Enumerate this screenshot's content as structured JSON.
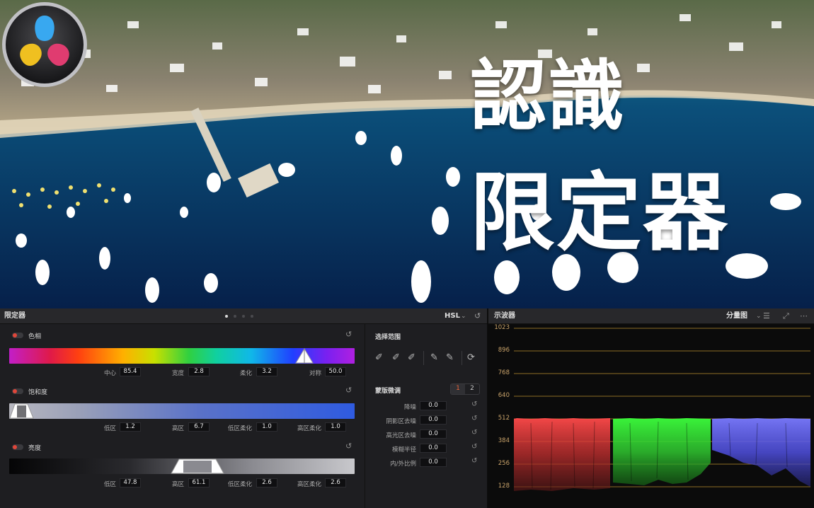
{
  "hero": {
    "title_line1": "認識",
    "title_line2": "限定器",
    "logo": "davinci-resolve-logo"
  },
  "qualifier": {
    "panel_title": "限定器",
    "mode": "HSL",
    "page_dots": 4,
    "active_page": 1,
    "hue": {
      "label": "色相",
      "fields": [
        {
          "label": "中心",
          "value": "85.4"
        },
        {
          "label": "宽度",
          "value": "2.8"
        },
        {
          "label": "柔化",
          "value": "3.2"
        },
        {
          "label": "对称",
          "value": "50.0"
        }
      ]
    },
    "saturation": {
      "label": "饱和度",
      "fields": [
        {
          "label": "低区",
          "value": "1.2"
        },
        {
          "label": "高区",
          "value": "6.7"
        },
        {
          "label": "低区柔化",
          "value": "1.0"
        },
        {
          "label": "高区柔化",
          "value": "1.0"
        }
      ]
    },
    "luminance": {
      "label": "亮度",
      "fields": [
        {
          "label": "低区",
          "value": "47.8"
        },
        {
          "label": "高区",
          "value": "61.1"
        },
        {
          "label": "低区柔化",
          "value": "2.6"
        },
        {
          "label": "高区柔化",
          "value": "2.6"
        }
      ]
    }
  },
  "selection_range": {
    "title": "选择范围",
    "tools": [
      "eyedropper-icon",
      "eyedropper-minus-icon",
      "eyedropper-plus-icon",
      "softness-minus-icon",
      "softness-plus-icon",
      "invert-icon"
    ]
  },
  "matte_finesse": {
    "title": "蒙版微调",
    "tabs": [
      "1",
      "2"
    ],
    "active_tab": "1",
    "fields": [
      {
        "label": "降噪",
        "value": "0.0"
      },
      {
        "label": "阴影区去噪",
        "value": "0.0"
      },
      {
        "label": "高光区去噪",
        "value": "0.0"
      },
      {
        "label": "模糊半径",
        "value": "0.0"
      },
      {
        "label": "内/外比例",
        "value": "0.0"
      }
    ]
  },
  "scope": {
    "panel_title": "示波器",
    "mode": "分量图",
    "ticks": [
      "1023",
      "896",
      "768",
      "640",
      "512",
      "384",
      "256",
      "128"
    ],
    "colors": {
      "red": "#ff4a4a",
      "green": "#3cff3c",
      "blue": "#6060ff",
      "gridline": "#b8902f"
    }
  }
}
